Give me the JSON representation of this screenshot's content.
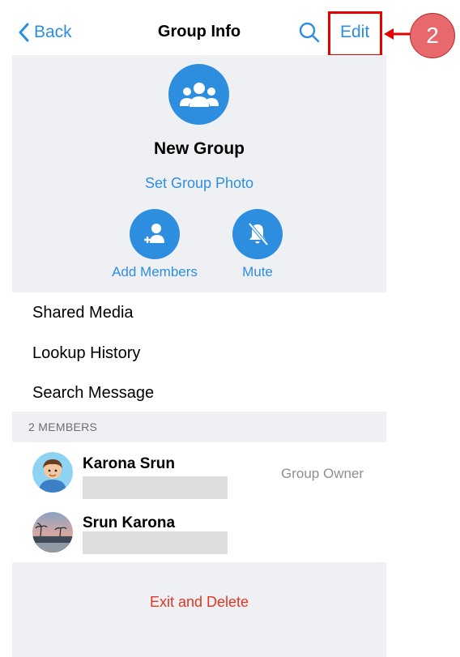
{
  "nav": {
    "back_label": "Back",
    "title": "Group Info",
    "edit_label": "Edit"
  },
  "annotation": {
    "step_number": "2",
    "highlight_color": "#e60000",
    "badge_color": "#e8696b"
  },
  "group": {
    "name": "New Group",
    "set_photo_label": "Set Group Photo",
    "avatar_icon": "group-people-icon"
  },
  "actions": [
    {
      "label": "Add Members",
      "icon": "add-member-icon"
    },
    {
      "label": "Mute",
      "icon": "bell-slash-icon"
    }
  ],
  "options": [
    "Shared Media",
    "Lookup History",
    "Search Message"
  ],
  "members_header": "2 MEMBERS",
  "members": [
    {
      "name": "Karona Srun",
      "role": "Group Owner"
    },
    {
      "name": "Srun Karona",
      "role": ""
    }
  ],
  "exit_label": "Exit and Delete",
  "colors": {
    "accent": "#2d8ee0",
    "destructive": "#e5341f",
    "panel_bg": "#eff0f4"
  }
}
